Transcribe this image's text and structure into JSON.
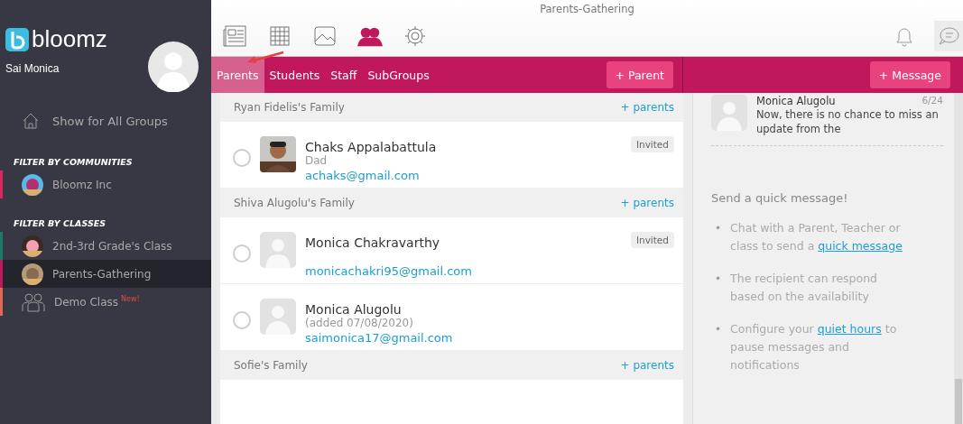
{
  "sidebar": {
    "brand": "bloomz",
    "user": "Sai Monica",
    "all_groups": "Show for All Groups",
    "sections": [
      {
        "title": "FILTER BY COMMUNITIES",
        "items": [
          {
            "label": "Bloomz Inc",
            "kind": "picture",
            "color": "#e0245e",
            "selected": false
          }
        ]
      },
      {
        "title": "FILTER BY CLASSES",
        "items": [
          {
            "label": "2nd-3rd Grade's Class",
            "kind": "picture",
            "color": "#1a7a6a",
            "selected": false
          },
          {
            "label": "Parents-Gathering",
            "kind": "picture",
            "color": "#c0185a",
            "selected": true
          },
          {
            "label": "Demo Class",
            "kind": "group",
            "color": "#e06a50",
            "selected": false,
            "badge": "New!"
          }
        ]
      }
    ]
  },
  "header": {
    "title": "Parents-Gathering",
    "toolbar": [
      {
        "kind": "news",
        "selected": false
      },
      {
        "kind": "calendar",
        "selected": false
      },
      {
        "kind": "photos",
        "selected": false
      },
      {
        "kind": "people",
        "selected": true
      },
      {
        "kind": "settings",
        "selected": false
      }
    ]
  },
  "tabs": [
    {
      "label": "Parents",
      "selected": true
    },
    {
      "label": "Students",
      "selected": false
    },
    {
      "label": "Staff",
      "selected": false
    },
    {
      "label": "SubGroups",
      "selected": false
    }
  ],
  "add_parent_button": "+ Parent",
  "add_message_button": "+ Message",
  "families": [
    {
      "name": "Ryan Fidelis's Family",
      "action": "+ parents",
      "members": [
        {
          "name": "Chaks Appalabattula",
          "role": "Dad",
          "email": "achaks@gmail.com",
          "status": "Invited",
          "kind": "picture",
          "checked": false
        }
      ]
    },
    {
      "name": "Shiva Alugolu's Family",
      "action": "+ parents",
      "members": [
        {
          "name": "Monica Chakravarthy",
          "email": "monicachakri95@gmail.com",
          "status": "Invited",
          "kind": "blank",
          "checked": false
        },
        {
          "name": "Monica Alugolu",
          "role": "(added 07/08/2020)",
          "email": "saimonica17@gmail.com",
          "kind": "blank",
          "checked": false
        }
      ]
    },
    {
      "name": "Sofie's Family",
      "action": "+ parents"
    }
  ],
  "messages": [
    {
      "name": "Monica Alugolu",
      "date": "6/24",
      "preview": "Now, there is no chance to miss an update from the"
    }
  ],
  "tips": {
    "title": "Send a quick message!",
    "items": [
      {
        "bullet": "•",
        "parts": [
          {
            "kind": "text",
            "text": "Chat with a Parent, Teacher or class to send a "
          },
          {
            "kind": "link",
            "text": "quick message"
          }
        ]
      },
      {
        "bullet": "•",
        "parts": [
          {
            "kind": "text",
            "text": "The recipient can respond based on the availability"
          }
        ]
      },
      {
        "bullet": "•",
        "parts": [
          {
            "kind": "text",
            "text": "Configure your "
          },
          {
            "kind": "link",
            "text": "quiet hours"
          },
          {
            "kind": "text",
            "text": " to pause messages and notifications"
          }
        ]
      }
    ]
  }
}
